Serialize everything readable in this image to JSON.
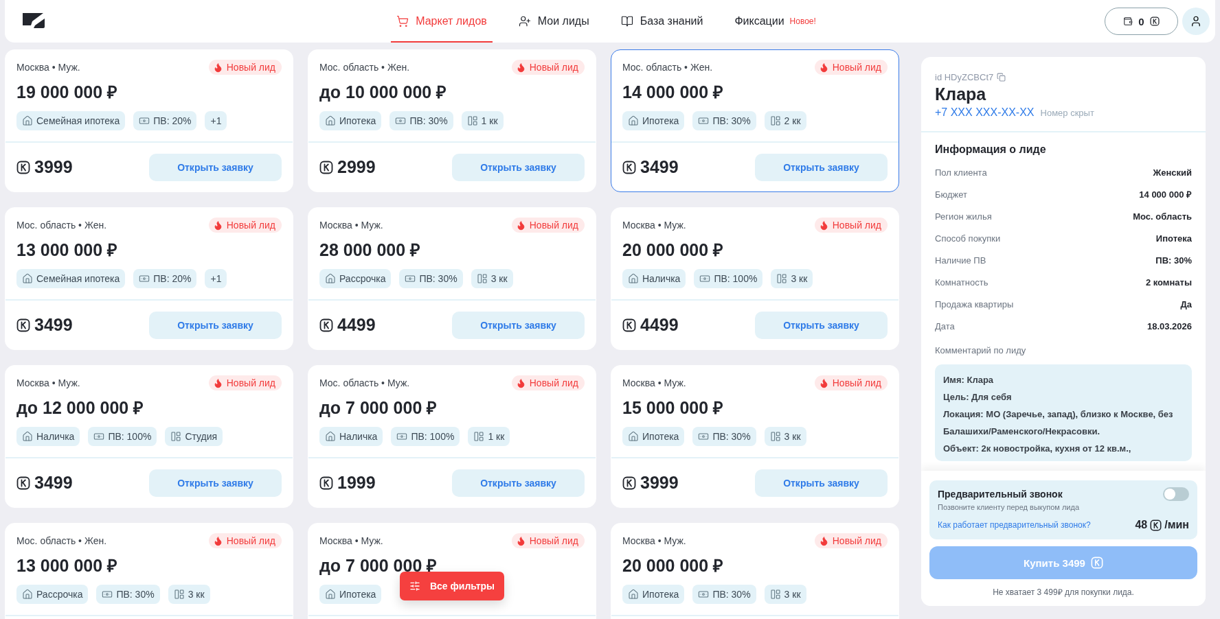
{
  "header": {
    "nav": [
      {
        "kind": "cart",
        "label": "Маркет лидов",
        "selected": true
      },
      {
        "kind": "user-plus",
        "label": "Мои лиды",
        "selected": false
      },
      {
        "kind": "book",
        "label": "База знаний",
        "selected": false
      },
      {
        "kind": "plain",
        "label": "Фиксации",
        "selected": false,
        "badge": "Новое!"
      }
    ],
    "wallet": "0"
  },
  "cards": [
    {
      "location": "Москва • Муж.",
      "badge": "Новый лид",
      "price": "19 000 000 ₽",
      "tags": [
        {
          "kind": "payment",
          "label": "Семейная ипотека"
        },
        {
          "kind": "pv",
          "label": "ПВ: 20%"
        },
        {
          "kind": "more",
          "label": "+1"
        }
      ],
      "cost": "3999",
      "button": "Открыть заявку",
      "selected": false
    },
    {
      "location": "Мос. область • Жен.",
      "badge": "Новый лид",
      "price": "до 10 000 000 ₽",
      "tags": [
        {
          "kind": "payment",
          "label": "Ипотека"
        },
        {
          "kind": "pv",
          "label": "ПВ: 30%"
        },
        {
          "kind": "rooms",
          "label": "1 кк"
        }
      ],
      "cost": "2999",
      "button": "Открыть заявку",
      "selected": false
    },
    {
      "location": "Мос. область • Жен.",
      "badge": "Новый лид",
      "price": "14 000 000 ₽",
      "tags": [
        {
          "kind": "payment",
          "label": "Ипотека"
        },
        {
          "kind": "pv",
          "label": "ПВ: 30%"
        },
        {
          "kind": "rooms",
          "label": "2 кк"
        }
      ],
      "cost": "3499",
      "button": "Открыть заявку",
      "selected": true
    },
    {
      "location": "Мос. область • Жен.",
      "badge": "Новый лид",
      "price": "13 000 000 ₽",
      "tags": [
        {
          "kind": "payment",
          "label": "Семейная ипотека"
        },
        {
          "kind": "pv",
          "label": "ПВ: 20%"
        },
        {
          "kind": "more",
          "label": "+1"
        }
      ],
      "cost": "3499",
      "button": "Открыть заявку",
      "selected": false
    },
    {
      "location": "Москва • Муж.",
      "badge": "Новый лид",
      "price": "28 000 000 ₽",
      "tags": [
        {
          "kind": "payment",
          "label": "Рассрочка"
        },
        {
          "kind": "pv",
          "label": "ПВ: 30%"
        },
        {
          "kind": "rooms",
          "label": "3 кк"
        }
      ],
      "cost": "4499",
      "button": "Открыть заявку",
      "selected": false
    },
    {
      "location": "Москва • Муж.",
      "badge": "Новый лид",
      "price": "20 000 000 ₽",
      "tags": [
        {
          "kind": "payment",
          "label": "Наличка"
        },
        {
          "kind": "pv",
          "label": "ПВ: 100%"
        },
        {
          "kind": "rooms",
          "label": "3 кк"
        }
      ],
      "cost": "4499",
      "button": "Открыть заявку",
      "selected": false
    },
    {
      "location": "Москва • Муж.",
      "badge": "Новый лид",
      "price": "до 12 000 000 ₽",
      "tags": [
        {
          "kind": "payment",
          "label": "Наличка"
        },
        {
          "kind": "pv",
          "label": "ПВ: 100%"
        },
        {
          "kind": "rooms",
          "label": "Студия"
        }
      ],
      "cost": "3499",
      "button": "Открыть заявку",
      "selected": false
    },
    {
      "location": "Мос. область • Муж.",
      "badge": "Новый лид",
      "price": "до 7 000 000 ₽",
      "tags": [
        {
          "kind": "payment",
          "label": "Наличка"
        },
        {
          "kind": "pv",
          "label": "ПВ: 100%"
        },
        {
          "kind": "rooms",
          "label": "1 кк"
        }
      ],
      "cost": "1999",
      "button": "Открыть заявку",
      "selected": false
    },
    {
      "location": "Москва • Муж.",
      "badge": "Новый лид",
      "price": "15 000 000 ₽",
      "tags": [
        {
          "kind": "payment",
          "label": "Ипотека"
        },
        {
          "kind": "pv",
          "label": "ПВ: 30%"
        },
        {
          "kind": "rooms",
          "label": "3 кк"
        }
      ],
      "cost": "3999",
      "button": "Открыть заявку",
      "selected": false
    },
    {
      "location": "Мос. область • Жен.",
      "badge": "Новый лид",
      "price": "13 000 000 ₽",
      "tags": [
        {
          "kind": "payment",
          "label": "Рассрочка"
        },
        {
          "kind": "pv",
          "label": "ПВ: 30%"
        },
        {
          "kind": "rooms",
          "label": "3 кк"
        }
      ],
      "selected": false
    },
    {
      "location": "Москва • Муж.",
      "badge": "Новый лид",
      "price": "до 7 000 000 ₽",
      "tags": [
        {
          "kind": "payment",
          "label": "Ипотека"
        }
      ],
      "selected": false
    },
    {
      "location": "Москва • Муж.",
      "badge": "Новый лид",
      "price": "20 000 000 ₽",
      "tags": [
        {
          "kind": "payment",
          "label": "Ипотека"
        },
        {
          "kind": "pv",
          "label": "ПВ: 30%"
        },
        {
          "kind": "rooms",
          "label": "3 кк"
        }
      ],
      "selected": false
    }
  ],
  "filter_button": "Все фильтры",
  "lead": {
    "id_label": "id HDyZCBCt7",
    "name": "Клара",
    "phone": "+7 XXX XXX-XX-XX",
    "phone_note": "Номер скрыт",
    "info_title": "Информация о лиде",
    "info": [
      {
        "label": "Пол клиента",
        "value": "Женский"
      },
      {
        "label": "Бюджет",
        "value": "14 000 000 ₽"
      },
      {
        "label": "Регион жилья",
        "value": "Мос. область"
      },
      {
        "label": "Способ покупки",
        "value": "Ипотека"
      },
      {
        "label": "Наличие ПВ",
        "value": "ПВ: 30%"
      },
      {
        "label": "Комнатность",
        "value": "2 комнаты"
      },
      {
        "label": "Продажа квартиры",
        "value": "Да"
      },
      {
        "label": "Дата",
        "value": "18.03.2026"
      }
    ],
    "comment_label": "Комментарий по лиду",
    "comment": [
      "Имя: Клара",
      "Цель: Для себя",
      "Локация: МО (Заречье, запад), близко к Москве, без Балашихи/Раменского/Некрасовки.",
      "Объект: 2к новостройка, кухня от 12 кв.м.,"
    ],
    "precall": {
      "title": "Предварительный звонок",
      "subtitle": "Позвоните клиенту перед выкупом лида",
      "link": "Как работает предварительный звонок?",
      "on": false,
      "rate": "48",
      "rate_unit": "/мин"
    },
    "buy": {
      "label": "Купить 3499",
      "disabled": true
    },
    "note": "Не хватает 3 499₽ для покупки лида."
  }
}
